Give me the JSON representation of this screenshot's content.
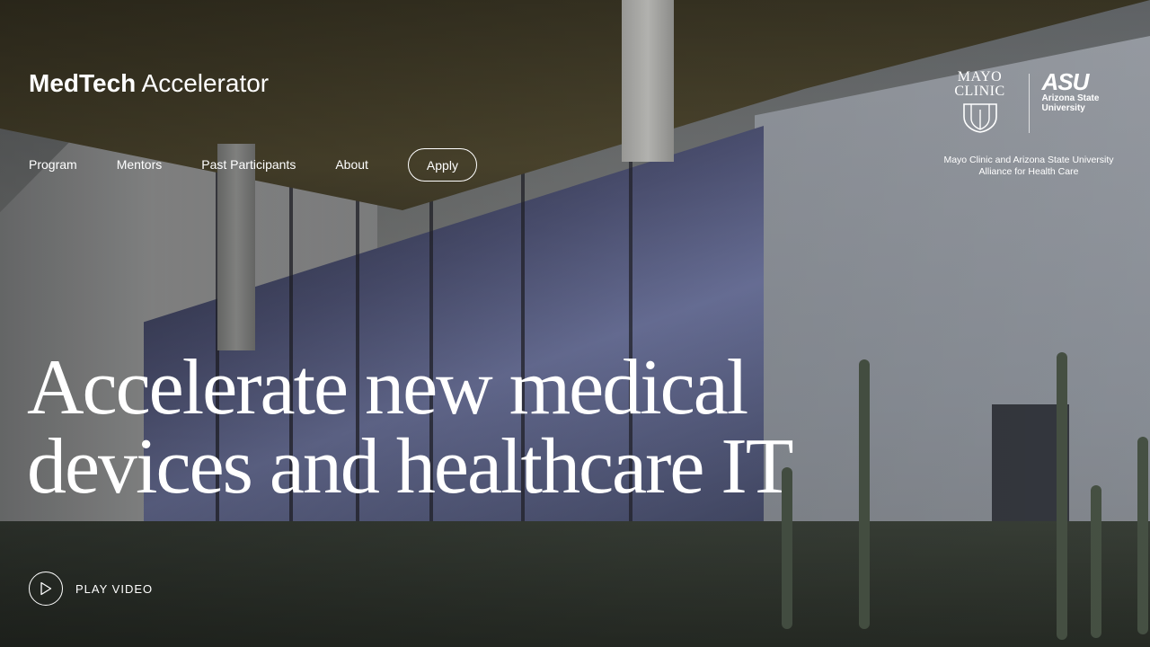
{
  "brand": {
    "bold": "MedTech",
    "rest": " Accelerator"
  },
  "nav": {
    "items": [
      "Program",
      "Mentors",
      "Past Participants",
      "About"
    ],
    "apply_label": "Apply"
  },
  "partner": {
    "mayo_line1": "MAYO",
    "mayo_line2": "CLINIC",
    "asu_mark": "ASU",
    "asu_line1": "Arizona State",
    "asu_line2": "University",
    "caption_line1": "Mayo Clinic and Arizona State University",
    "caption_line2": "Alliance for Health Care"
  },
  "hero": {
    "line1": "Accelerate new medical",
    "line2": "devices and healthcare IT"
  },
  "video": {
    "label": "PLAY VIDEO",
    "icon": "play-icon"
  },
  "colors": {
    "text": "#ffffff",
    "overlay": "#000000"
  }
}
